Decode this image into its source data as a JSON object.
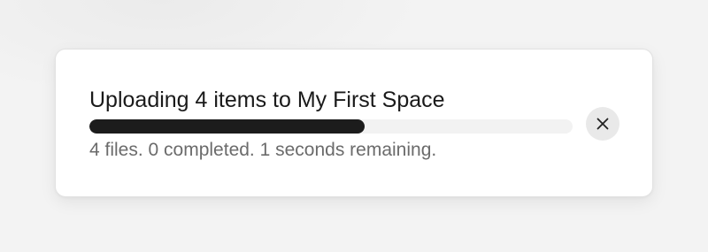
{
  "upload_toast": {
    "title": "Uploading 4 items to My First Space",
    "status": "4 files. 0 completed. 1 seconds remaining.",
    "progress_fraction": 0.57,
    "close_icon": "close-icon",
    "colors": {
      "progress_fill": "#1c1c1c",
      "progress_track": "#f2f2f2",
      "title_text": "#1a1a1a",
      "status_text": "#6b6b6b",
      "close_button_bg": "#e9e9e9"
    }
  }
}
